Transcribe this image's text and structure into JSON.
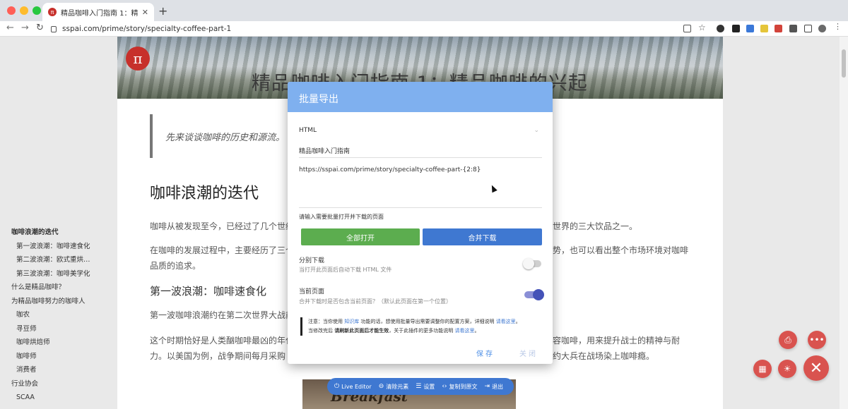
{
  "browser": {
    "tab_title": "精品咖啡入门指南 1：精品咖啡的兴起",
    "tab_favicon": "π",
    "tab_close": "✕",
    "new_tab": "+",
    "url": "sspai.com/prime/story/specialty-coffee-part-1",
    "back": "←",
    "forward": "→",
    "reload": "↻"
  },
  "article": {
    "logo": "π",
    "banner_title": "精品咖啡入门指南 1：精品咖啡的兴起",
    "quote": "先来谈谈咖啡的历史和源流。",
    "heading": "咖啡浪潮的迭代",
    "para1_left": "咖啡从被发现至今，已经过了几个世纪",
    "para1_right": "世界的三大饮品之一。",
    "para2_left": "在咖啡的发展过程中，主要经历了三个",
    "para2_right": "势，也可以看出整个市场环境对咖啡",
    "para2_line2": "品质的追求。",
    "subheading": "第一波浪潮：咖啡速食化",
    "para3_left": "第一波咖啡浪潮约在第二次世界大战前",
    "para4_left": "这个时期恰好是人类酗咖啡最凶的年代",
    "para4_right": "容咖啡，用来提升战士的精神与耐",
    "para4_line2_left": "力。以美国为例，战争期间每月采购",
    "para4_line2_right": "约大兵在战场染上咖啡瘾。",
    "photo_text": "Breakfast"
  },
  "toc": {
    "items": [
      {
        "label": "咖啡浪潮的迭代"
      },
      {
        "label": "第一波浪潮：咖啡速食化"
      },
      {
        "label": "第二波浪潮：欧式重烘…"
      },
      {
        "label": "第三波浪潮：咖啡美学化"
      },
      {
        "label": "什么是精品咖啡？"
      },
      {
        "label": "为精品咖啡努力的咖啡人"
      },
      {
        "label": "咖农"
      },
      {
        "label": "寻豆师"
      },
      {
        "label": "咖啡烘焙师"
      },
      {
        "label": "咖啡师"
      },
      {
        "label": "消费者"
      },
      {
        "label": "行业协会"
      },
      {
        "label": "SCAA"
      }
    ]
  },
  "modal": {
    "title": "批量导出",
    "format_value": "HTML",
    "name_value": "精品咖啡入门指南",
    "url_pattern": "https://sspai.com/prime/story/specialty-coffee-part-{2:8}",
    "hint": "请输入需要批量打开并下载的页面",
    "open_all": "全部打开",
    "merge_download": "合并下载",
    "opt_split_title": "分别下载",
    "opt_split_desc": "当打开此页面后自动下载 HTML 文件",
    "opt_split_on": false,
    "opt_current_title": "当前页面",
    "opt_current_desc": "合并下载时是否包含当前页面？（默认此页面在第一个位置）",
    "opt_current_on": true,
    "notice_1a": "注意：当你使用 ",
    "notice_1_link": "知识库",
    "notice_1b": " 功能的话，想使用批量导出需要调整你的配置方案，详细说明 ",
    "notice_1_link2": "请看这里",
    "notice_1c": "。",
    "notice_2a": "当修改完后 ",
    "notice_2_bold": "请刷新此页面后才能生效",
    "notice_2b": "，关于此插件的更多功能说明 ",
    "notice_2_link": "请看这里",
    "notice_2c": "。",
    "save": "保存",
    "close": "关闭"
  },
  "bottom_toolbar": {
    "live_editor": "Live Editor",
    "remove": "清除元素",
    "settings": "设置",
    "copy_source": "复制到原文",
    "exit": "退出"
  },
  "colors": {
    "modal_header": "#7fb0ef",
    "btn_green": "#5cad4f",
    "btn_blue": "#3f78d1",
    "fab_red": "#d9534f"
  }
}
